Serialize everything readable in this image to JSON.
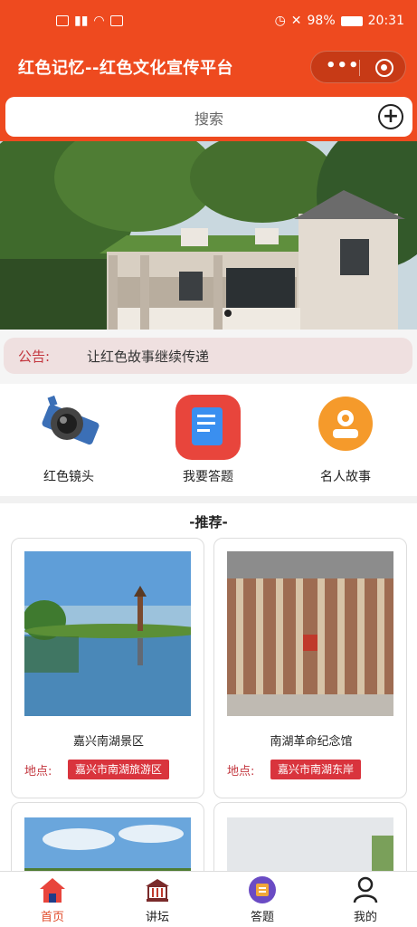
{
  "status_bar": {
    "left": "▪▪ull ▪",
    "battery": "98%",
    "time": "20:31"
  },
  "header": {
    "title": "红色记忆--红色文化宣传平台",
    "more_icon": "more-dots-icon",
    "close_icon": "target-icon"
  },
  "search": {
    "placeholder": "搜索",
    "add_icon": "plus-circle-icon"
  },
  "notice": {
    "label": "公告:",
    "text": "让红色故事继续传递"
  },
  "quick_nav": [
    {
      "label": "红色镜头",
      "icon": "camera-icon"
    },
    {
      "label": "我要答题",
      "icon": "quiz-icon"
    },
    {
      "label": "名人故事",
      "icon": "person-icon"
    }
  ],
  "recommend": {
    "title": "-推荐-",
    "location_label": "地点:",
    "items": [
      {
        "name": "嘉兴南湖景区",
        "location": "嘉兴市南湖旅游区"
      },
      {
        "name": "南湖革命纪念馆",
        "location": "嘉兴市南湖东岸"
      }
    ]
  },
  "tabbar": [
    {
      "label": "首页",
      "icon": "home-icon",
      "active": true
    },
    {
      "label": "讲坛",
      "icon": "lecture-icon",
      "active": false
    },
    {
      "label": "答题",
      "icon": "quiz-tab-icon",
      "active": false
    },
    {
      "label": "我的",
      "icon": "user-icon",
      "active": false
    }
  ],
  "colors": {
    "primary": "#ee4a1f",
    "accent_red": "#d9343d",
    "notice_bg": "#efe0e0"
  }
}
